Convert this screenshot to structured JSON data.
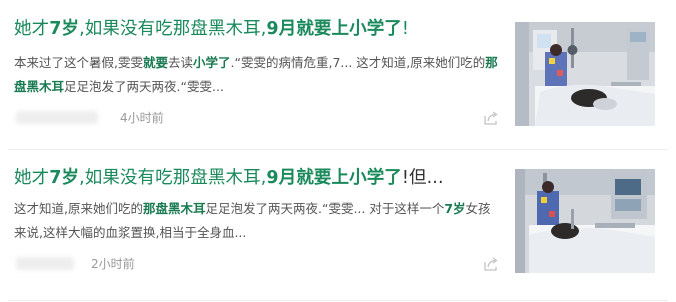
{
  "articles": [
    {
      "title_parts": [
        {
          "text": "她才"
        },
        {
          "text": "7岁",
          "em": true
        },
        {
          "text": ",如果没有吃那盘黑木耳,"
        },
        {
          "text": "9月",
          "em": true
        },
        {
          "text": "就要上小学了",
          "em": true
        },
        {
          "text": "!"
        }
      ],
      "summary_parts": [
        {
          "text": "本来过了这个暑假,雯雯"
        },
        {
          "text": "就要",
          "em": true
        },
        {
          "text": "去读"
        },
        {
          "text": "小学了",
          "em": true
        },
        {
          "text": ".“雯雯的病情危重,7... 这才知道,原来她们吃的"
        },
        {
          "text": "那盘黑木耳",
          "em": true
        },
        {
          "text": "足足泡发了两天两夜.“雯雯..."
        }
      ],
      "time": "4小时前",
      "thumbnail_icon": "hospital-patient-photo"
    },
    {
      "title_parts": [
        {
          "text": "她才"
        },
        {
          "text": "7岁",
          "em": true
        },
        {
          "text": ",如果没有吃那盘黑木耳,"
        },
        {
          "text": "9月",
          "em": true
        },
        {
          "text": "就要上小学了",
          "em": true
        },
        {
          "text": "!但...",
          "dark": true
        }
      ],
      "summary_parts": [
        {
          "text": "这才知道,原来她们吃的"
        },
        {
          "text": "那盘黑木耳",
          "em": true
        },
        {
          "text": "足足泡发了两天两夜.“雯雯... 对于这样一个"
        },
        {
          "text": "7岁",
          "em": true
        },
        {
          "text": "女孩来说,这样大幅的血浆置换,相当于全身血..."
        }
      ],
      "time": "2小时前",
      "thumbnail_icon": "hospital-patient-photo"
    }
  ],
  "colors": {
    "title_green": "#1a8a5c",
    "highlight_green": "#1a7a52",
    "summary_text": "#555555",
    "meta_text": "#999999"
  }
}
